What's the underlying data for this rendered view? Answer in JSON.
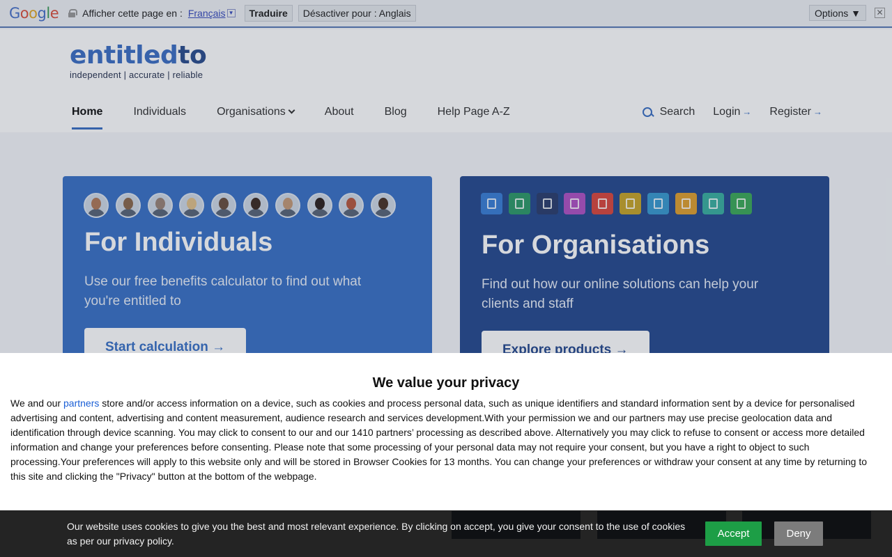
{
  "translate_bar": {
    "logo": [
      "G",
      "o",
      "o",
      "g",
      "l",
      "e"
    ],
    "prompt": "Afficher cette page en :",
    "language": "Français",
    "translate_button": "Traduire",
    "disable_button": "Désactiver pour : Anglais",
    "options_button": "Options ▼",
    "close": "✕"
  },
  "header": {
    "logo_main": "entitled",
    "logo_suffix": "to",
    "tagline": "independent | accurate | reliable",
    "nav": [
      {
        "label": "Home",
        "active": true
      },
      {
        "label": "Individuals"
      },
      {
        "label": "Organisations"
      },
      {
        "label": "About"
      },
      {
        "label": "Blog"
      },
      {
        "label": "Help Page A-Z"
      }
    ],
    "search": "Search",
    "login": "Login",
    "register": "Register",
    "arrow": "→"
  },
  "cards": {
    "individuals": {
      "title": "For Individuals",
      "description": "Use our free benefits calculator to find out what you're entitled to",
      "button": "Start calculation →"
    },
    "organisations": {
      "title": "For Organisations",
      "description": "Find out how our online solutions can help your clients and staff",
      "button": "Explore products →"
    }
  },
  "face_colors": [
    "#b07a5a",
    "#8c6a4e",
    "#9a8478",
    "#e0c08a",
    "#6a5040",
    "#3e2c24",
    "#c49a78",
    "#2e2320",
    "#b85a40",
    "#4a3428"
  ],
  "icon_colors": [
    "#3b7fd6",
    "#2f9a6a",
    "#2c3f6e",
    "#b054c4",
    "#d9493f",
    "#c7a52a",
    "#3a9ad0",
    "#e0a030",
    "#3bb0a0",
    "#3eaa5a"
  ],
  "privacy": {
    "title": "We value your privacy",
    "body_start": "We and our ",
    "partners_link": "partners",
    "body_rest": " store and/or access information on a device, such as cookies and process personal data, such as unique identifiers and standard information sent by a device for personalised advertising and content, advertising and content measurement, audience research and services development.With your permission we and our partners may use precise geolocation data and identification through device scanning. You may click to consent to our and our 1410 partners’ processing as described above. Alternatively you may click to refuse to consent or access more detailed information and change your preferences before consenting. Please note that some processing of your personal data may not require your consent, but you have a right to object to such processing.Your preferences will apply to this website only and will be stored in Browser Cookies for 13 months. You can change your preferences or withdraw your consent at any time by returning to this site and clicking the \"Privacy\" button at the bottom of the webpage."
  },
  "cookie_bar": {
    "text": "Our website uses cookies to give you the best and most relevant experience. By clicking on accept, you give your consent to the use of cookies as per our privacy policy.",
    "accept": "Accept",
    "deny": "Deny"
  }
}
